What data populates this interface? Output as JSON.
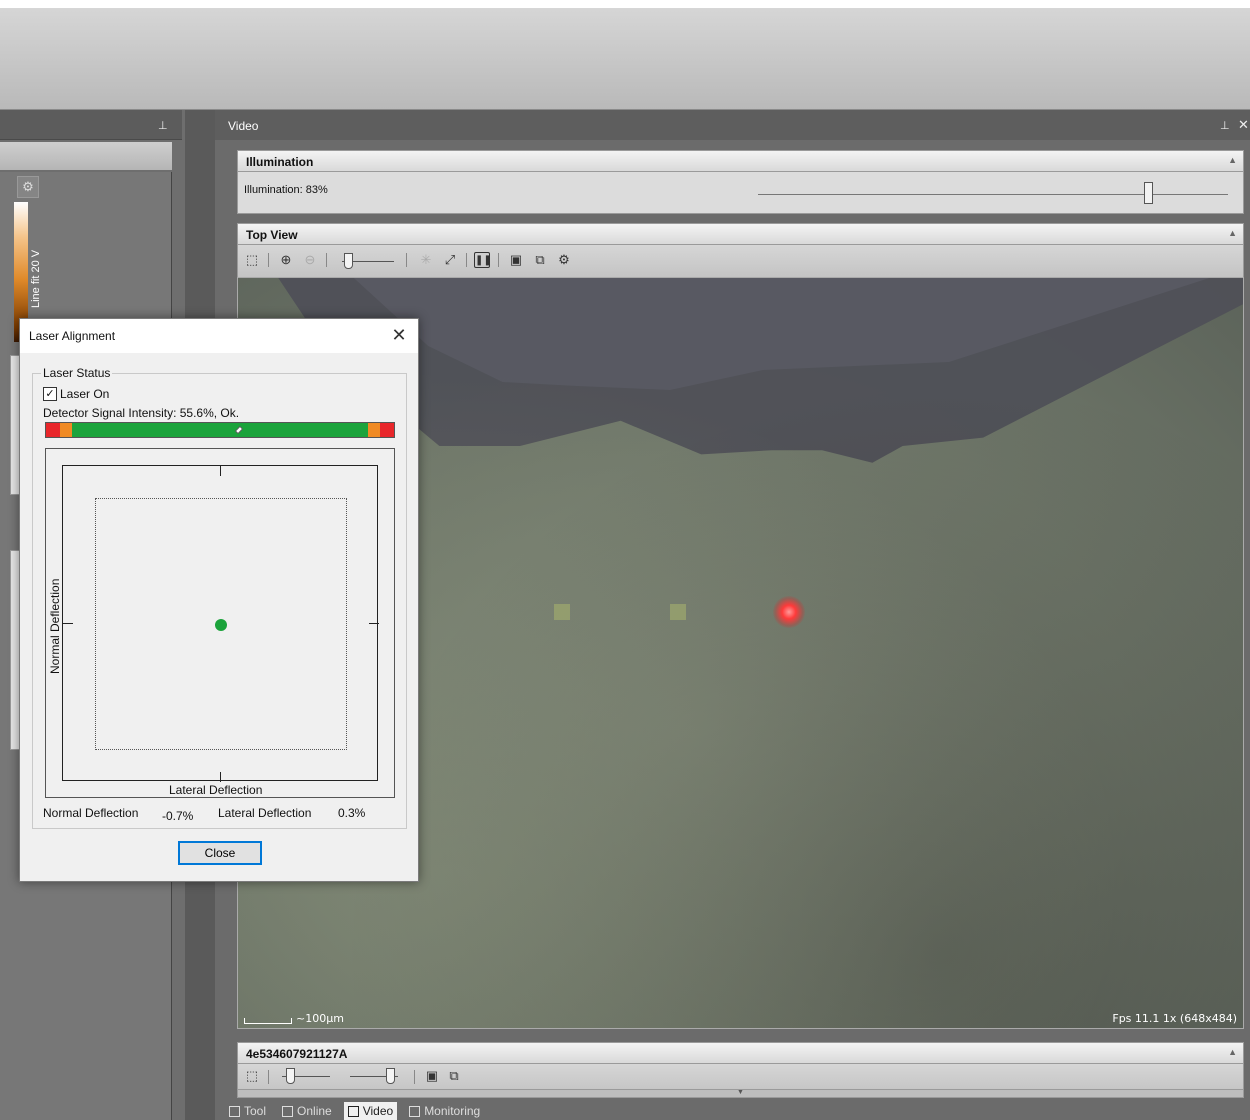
{
  "video_panel": {
    "title": "Video",
    "pin_icon": "pin-icon",
    "close_icon": "close-icon"
  },
  "illumination": {
    "title": "Illumination",
    "label": "Illumination: 83%",
    "value_percent": 83
  },
  "top_view": {
    "title": "Top View",
    "toolbar_icons": [
      "select-icon",
      "zoom-in-icon",
      "zoom-out-icon",
      "zoom-slider",
      "crosshair-icon",
      "fit-icon",
      "pause-icon",
      "save-icon",
      "copy-icon",
      "gear-icon"
    ],
    "scale_label": "~100µm",
    "fps_label": "Fps 11.1 1x (648x484)"
  },
  "camera_panel": {
    "title": "4e534607921127A"
  },
  "bottom_tabs": [
    {
      "label": "Tool",
      "active": false
    },
    {
      "label": "Online",
      "active": false
    },
    {
      "label": "Video",
      "active": true
    },
    {
      "label": "Monitoring",
      "active": false
    }
  ],
  "left_panel": {
    "colorbar_label": "Line fit 20 V",
    "gear_icon": "gear-icon"
  },
  "dialog": {
    "title": "Laser Alignment",
    "group_label": "Laser Status",
    "laser_on_label": "Laser On",
    "laser_on_checked": true,
    "signal_text": "Detector Signal Intensity: 55.6%, Ok.",
    "signal_percent": 55.6,
    "axis_y_label": "Normal Deflection",
    "axis_x_label": "Lateral Deflection",
    "normal_label": "Normal Deflection",
    "normal_value": "-0.7%",
    "lateral_label": "Lateral Deflection",
    "lateral_value": "0.3%",
    "close_label": "Close",
    "colors": {
      "ok": "#1ba33b",
      "warn": "#f08a24",
      "error": "#e8262a"
    }
  }
}
